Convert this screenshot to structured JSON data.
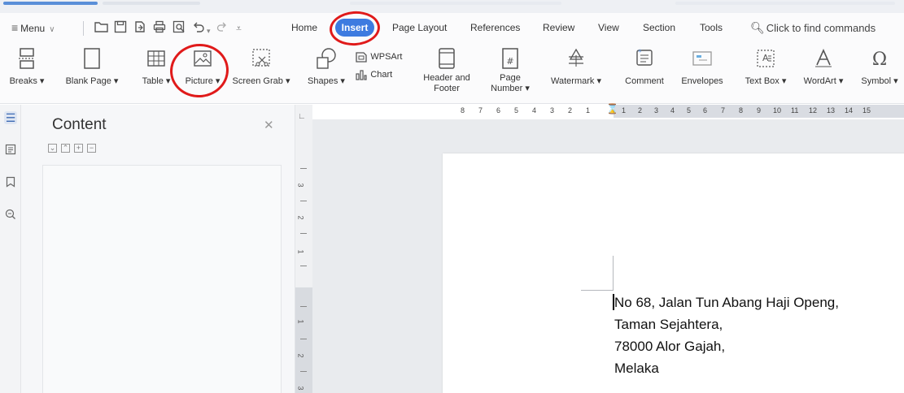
{
  "menubar": {
    "menu_label": "Menu",
    "tabs": [
      {
        "label": "Home"
      },
      {
        "label": "Insert"
      },
      {
        "label": "Page Layout"
      },
      {
        "label": "References"
      },
      {
        "label": "Review"
      },
      {
        "label": "View"
      },
      {
        "label": "Section"
      },
      {
        "label": "Tools"
      }
    ],
    "find_placeholder": "Click to find commands"
  },
  "ribbon": {
    "items": [
      {
        "label": "Breaks",
        "icon": "breaks-icon"
      },
      {
        "label": "Blank Page",
        "icon": "blank-page-icon"
      },
      {
        "label": "Table",
        "icon": "table-icon"
      },
      {
        "label": "Picture",
        "icon": "picture-icon"
      },
      {
        "label": "Screen Grab",
        "icon": "screen-grab-icon"
      },
      {
        "label": "Shapes",
        "icon": "shapes-icon"
      },
      {
        "label": "WPSArt",
        "icon": "wpsart-icon"
      },
      {
        "label": "Chart",
        "icon": "chart-icon"
      },
      {
        "label": "Header and",
        "label2": "Footer",
        "icon": "header-footer-icon"
      },
      {
        "label": "Page",
        "label2": "Number",
        "icon": "page-number-icon"
      },
      {
        "label": "Watermark",
        "icon": "watermark-icon"
      },
      {
        "label": "Comment",
        "icon": "comment-icon"
      },
      {
        "label": "Envelopes",
        "icon": "envelopes-icon"
      },
      {
        "label": "Text Box",
        "icon": "text-box-icon"
      },
      {
        "label": "WordArt",
        "icon": "wordart-icon"
      },
      {
        "label": "Symbol",
        "icon": "symbol-icon"
      }
    ]
  },
  "panel": {
    "title": "Content"
  },
  "ruler": {
    "left_numbers": [
      "8",
      "7",
      "6",
      "5",
      "4",
      "3",
      "2",
      "1"
    ],
    "right_numbers": [
      "1",
      "2",
      "3",
      "4",
      "5",
      "6",
      "7",
      "8",
      "9",
      "10",
      "11",
      "12",
      "13",
      "14",
      "15"
    ],
    "vertical_numbers": [
      "3",
      "2",
      "1",
      "1",
      "2",
      "3"
    ]
  },
  "document": {
    "lines": [
      "No 68, Jalan Tun Abang Haji Openg,",
      "Taman Sejahtera,",
      "78000 Alor Gajah,",
      "Melaka"
    ]
  },
  "colors": {
    "accent": "#3d7be0",
    "annotation": "#e01a1a"
  }
}
